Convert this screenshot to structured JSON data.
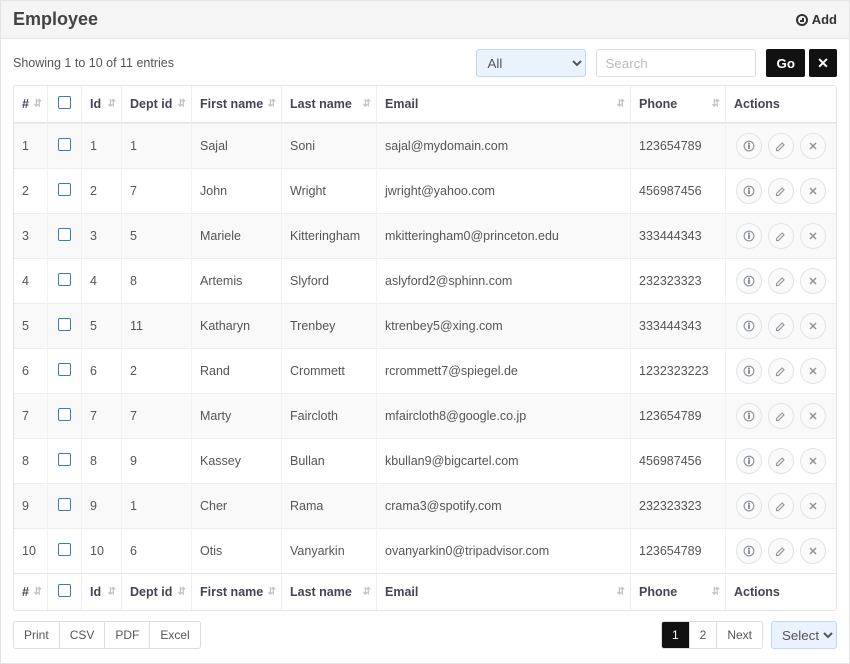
{
  "header": {
    "title": "Employee",
    "add_label": "Add"
  },
  "info_text": "Showing 1 to 10 of 11 entries",
  "filter": {
    "options": [
      "All"
    ],
    "selected": "All"
  },
  "search": {
    "placeholder": "Search",
    "value": "",
    "go_label": "Go"
  },
  "columns": {
    "row_num": "#",
    "id": "Id",
    "dept_id": "Dept id",
    "first_name": "First name",
    "last_name": "Last name",
    "email": "Email",
    "phone": "Phone",
    "actions": "Actions"
  },
  "rows": [
    {
      "n": "1",
      "id": "1",
      "dept": "1",
      "first": "Sajal",
      "last": "Soni",
      "email": "sajal@mydomain.com",
      "phone": "123654789"
    },
    {
      "n": "2",
      "id": "2",
      "dept": "7",
      "first": "John",
      "last": "Wright",
      "email": "jwright@yahoo.com",
      "phone": "456987456"
    },
    {
      "n": "3",
      "id": "3",
      "dept": "5",
      "first": "Mariele",
      "last": "Kitteringham",
      "email": "mkitteringham0@princeton.edu",
      "phone": "333444343"
    },
    {
      "n": "4",
      "id": "4",
      "dept": "8",
      "first": "Artemis",
      "last": "Slyford",
      "email": "aslyford2@sphinn.com",
      "phone": "232323323"
    },
    {
      "n": "5",
      "id": "5",
      "dept": "11",
      "first": "Katharyn",
      "last": "Trenbey",
      "email": "ktrenbey5@xing.com",
      "phone": "333444343"
    },
    {
      "n": "6",
      "id": "6",
      "dept": "2",
      "first": "Rand",
      "last": "Crommett",
      "email": "rcrommett7@spiegel.de",
      "phone": "1232323223"
    },
    {
      "n": "7",
      "id": "7",
      "dept": "7",
      "first": "Marty",
      "last": "Faircloth",
      "email": "mfaircloth8@google.co.jp",
      "phone": "123654789"
    },
    {
      "n": "8",
      "id": "8",
      "dept": "9",
      "first": "Kassey",
      "last": "Bullan",
      "email": "kbullan9@bigcartel.com",
      "phone": "456987456"
    },
    {
      "n": "9",
      "id": "9",
      "dept": "1",
      "first": "Cher",
      "last": "Rama",
      "email": "crama3@spotify.com",
      "phone": "232323323"
    },
    {
      "n": "10",
      "id": "10",
      "dept": "6",
      "first": "Otis",
      "last": "Vanyarkin",
      "email": "ovanyarkin0@tripadvisor.com",
      "phone": "123654789"
    }
  ],
  "export": {
    "print": "Print",
    "csv": "CSV",
    "pdf": "PDF",
    "excel": "Excel"
  },
  "pagination": {
    "pages": [
      "1",
      "2"
    ],
    "active": "1",
    "next": "Next",
    "perpage_selected": "Select"
  }
}
